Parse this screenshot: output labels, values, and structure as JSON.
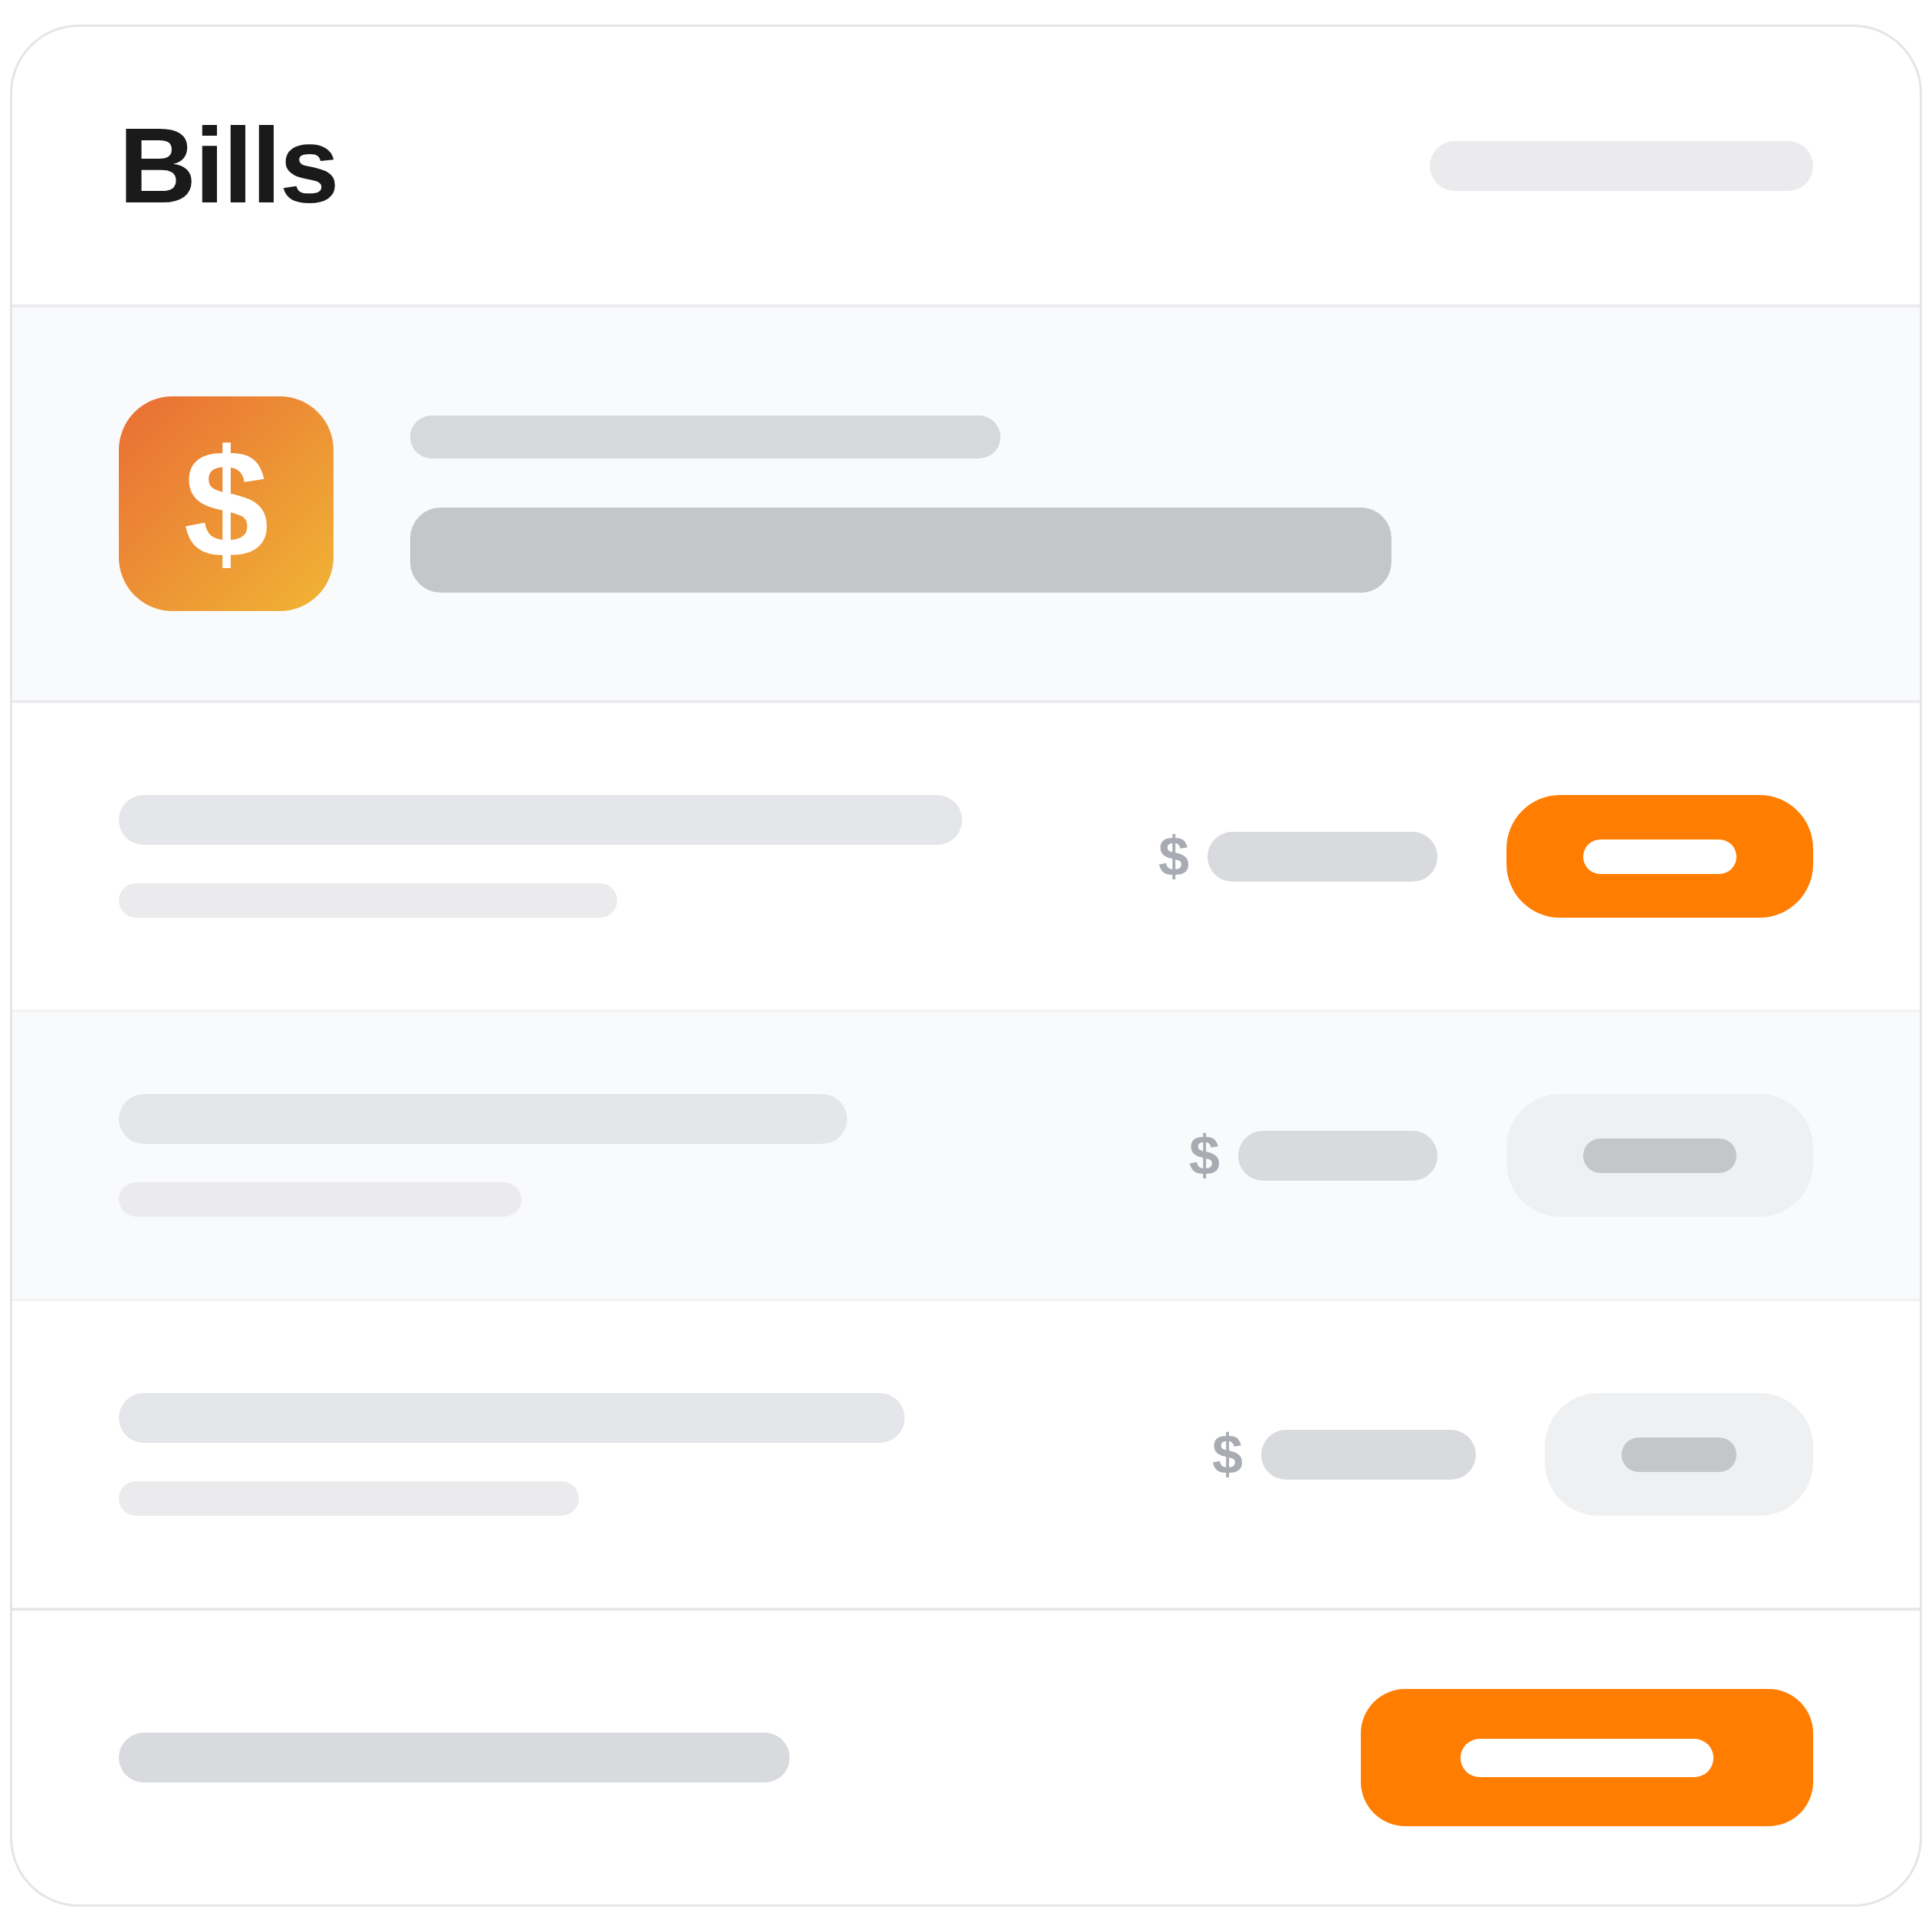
{
  "header": {
    "title": "Bills"
  },
  "summary": {
    "icon_symbol": "$"
  },
  "bills": [
    {
      "currency": "$",
      "disabled": false
    },
    {
      "currency": "$",
      "disabled": true
    },
    {
      "currency": "$",
      "disabled": true
    }
  ]
}
